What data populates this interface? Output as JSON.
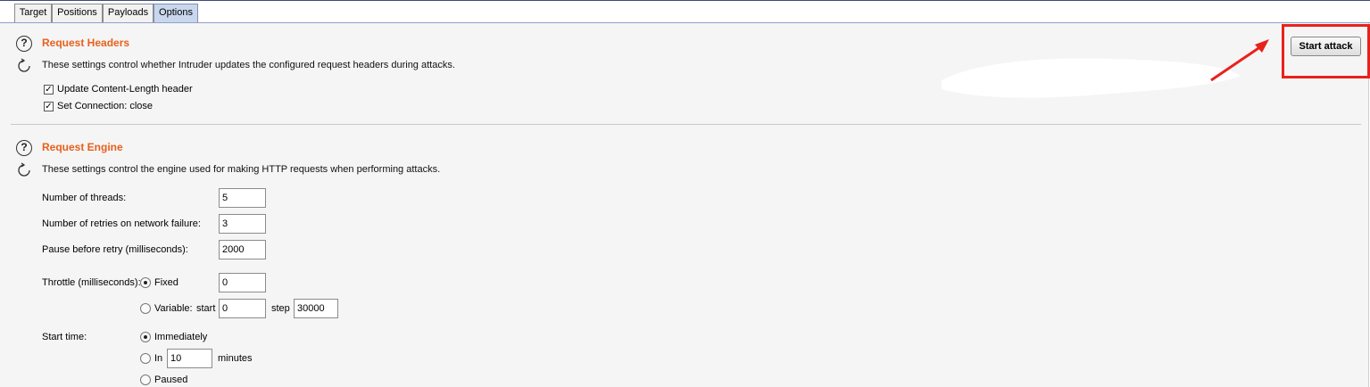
{
  "tabs": [
    {
      "label": "Target"
    },
    {
      "label": "Positions"
    },
    {
      "label": "Payloads"
    },
    {
      "label": "Options"
    }
  ],
  "active_tab": "Options",
  "start_attack_label": "Start attack",
  "request_headers": {
    "title": "Request Headers",
    "description": "These settings control whether Intruder updates the configured request headers during attacks.",
    "options": [
      {
        "label": "Update Content-Length header",
        "checked": true
      },
      {
        "label": "Set Connection: close",
        "checked": true
      }
    ]
  },
  "request_engine": {
    "title": "Request Engine",
    "description": "These settings control the engine used for making HTTP requests when performing attacks.",
    "threads": {
      "label": "Number of threads:",
      "value": "5"
    },
    "retries": {
      "label": "Number of retries on network failure:",
      "value": "3"
    },
    "pause": {
      "label": "Pause before retry (milliseconds):",
      "value": "2000"
    },
    "throttle": {
      "label": "Throttle (milliseconds):",
      "fixed_label": "Fixed",
      "fixed_value": "0",
      "variable_label": "Variable:",
      "start_label": "start",
      "start_value": "0",
      "step_label": "step",
      "step_value": "30000",
      "selected": "Fixed"
    },
    "start_time": {
      "label": "Start time:",
      "immediately_label": "Immediately",
      "in_label": "In",
      "in_value": "10",
      "minutes_label": "minutes",
      "paused_label": "Paused",
      "selected": "Immediately"
    }
  },
  "colors": {
    "section_title": "#e8601c",
    "annotation": "#e8221b",
    "active_tab": "#c9d7ee"
  },
  "icons": [
    "help-icon",
    "refresh-icon",
    "checkbox-checked",
    "radio-button"
  ]
}
